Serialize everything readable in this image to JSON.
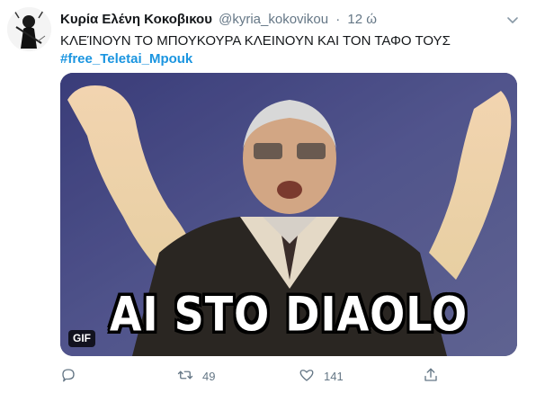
{
  "tweet": {
    "author_name": "Κυρία Ελένη Κοκοβικου",
    "author_handle": "@kyria_kokovikou",
    "separator": "·",
    "time": "12 ώ",
    "text": "ΚΛΕΊΝΟΥΝ ΤΟ ΜΠΟΥΚΟΥΡΑ ΚΛΕΙΝΟΥΝ ΚΑΙ ΤΟΝ ΤΑΦΟ ΤΟΥΣ",
    "hashtag": "#free_Teletai_Mpouk",
    "media": {
      "caption": "AI STO DIAOLO",
      "badge": "GIF"
    },
    "actions": {
      "reply_count": "",
      "retweet_count": "49",
      "like_count": "141"
    },
    "icons": {
      "menu": "chevron-down-icon",
      "reply": "reply-icon",
      "retweet": "retweet-icon",
      "like": "heart-icon",
      "share": "share-icon"
    },
    "colors": {
      "link": "#1b95e0",
      "muted": "#657786",
      "text": "#14171a"
    }
  }
}
